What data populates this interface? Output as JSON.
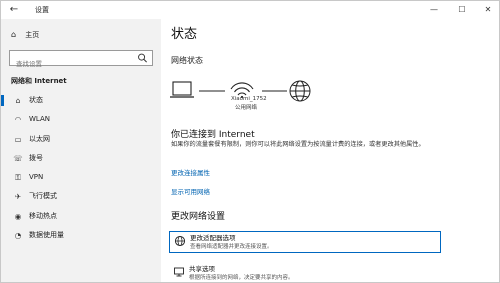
{
  "window": {
    "title": "设置",
    "back_icon": "arrow-left-icon",
    "controls": {
      "minimize": "—",
      "maximize": "☐",
      "close": "✕"
    }
  },
  "sidebar": {
    "home_label": "主页",
    "search_placeholder": "查找设置",
    "section_title": "网络和 Internet",
    "items": [
      {
        "label": "状态",
        "icon": "home-status-icon",
        "glyph": "⌂",
        "active": true
      },
      {
        "label": "WLAN",
        "icon": "wifi-icon",
        "glyph": "◠",
        "active": false
      },
      {
        "label": "以太网",
        "icon": "ethernet-icon",
        "glyph": "▭",
        "active": false
      },
      {
        "label": "拨号",
        "icon": "dialup-icon",
        "glyph": "☏",
        "active": false
      },
      {
        "label": "VPN",
        "icon": "vpn-icon",
        "glyph": "⚿",
        "active": false
      },
      {
        "label": "飞行模式",
        "icon": "airplane-icon",
        "glyph": "✈",
        "active": false
      },
      {
        "label": "移动热点",
        "icon": "hotspot-icon",
        "glyph": "◉",
        "active": false
      },
      {
        "label": "数据使用量",
        "icon": "data-usage-icon",
        "glyph": "◔",
        "active": false
      }
    ]
  },
  "main": {
    "title": "状态",
    "network_status_heading": "网络状态",
    "network_name": "Xiaomi_1752",
    "network_type": "公用网络",
    "connected_heading": "你已连接到 Internet",
    "description": "如果你的流量套餐有限制，则你可以将此网络设置为按流量计费的连接，或者更改其他属性。",
    "link_change_props": "更改连接属性",
    "link_show_networks": "显示可用网络",
    "change_settings_heading": "更改网络设置",
    "options": [
      {
        "title": "更改适配器选项",
        "subtitle": "查看网络适配器并更改连接设置。",
        "icon": "adapter-icon"
      },
      {
        "title": "共享选项",
        "subtitle": "根据所连接到的网络，决定要共享的内容。",
        "icon": "share-icon"
      }
    ]
  },
  "colors": {
    "accent": "#0067c0",
    "link": "#0063b1",
    "sidebar_bg": "#f2f2f2"
  }
}
